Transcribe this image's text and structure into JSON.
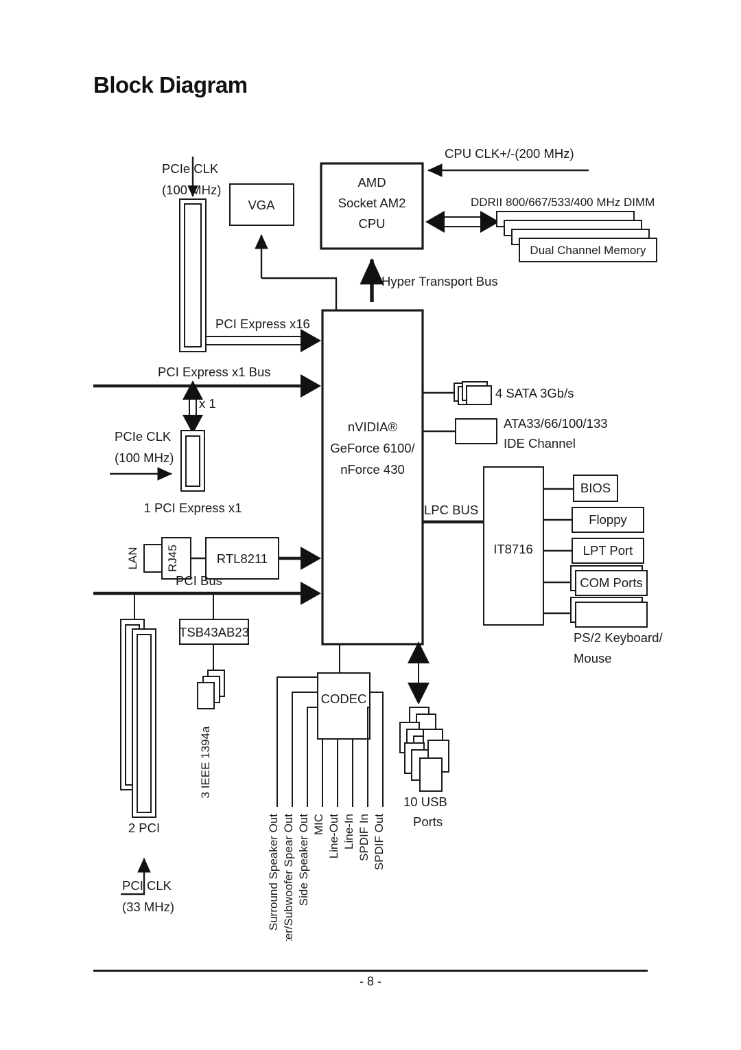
{
  "document": {
    "title": "Block Diagram",
    "footer_page_label": "- 8 -"
  },
  "clocks": {
    "pcie_clk_top_line1": "PCIe CLK",
    "pcie_clk_top_line2": "(100 MHz)",
    "pcie_clk_mid_line1": "PCIe CLK",
    "pcie_clk_mid_line2": "(100 MHz)",
    "pci_clk_line1": "PCI CLK",
    "pci_clk_line2": "(33 MHz)",
    "cpu_clk": "CPU CLK+/-(200 MHz)"
  },
  "blocks": {
    "vga": "VGA",
    "cpu_line1": "AMD",
    "cpu_line2": "Socket AM2",
    "cpu_line3": "CPU",
    "chipset_line1": "nVIDIA®",
    "chipset_line2": "GeForce 6100/",
    "chipset_line3": "nForce 430",
    "memory": "Dual Channel Memory",
    "memory_spec": "DDRII 800/667/533/400 MHz DIMM",
    "lan_phy": "RTL8211",
    "firewire_chip": "TSB43AB23",
    "super_io": "IT8716",
    "codec": "CODEC",
    "bios": "BIOS",
    "floppy": "Floppy",
    "lpt_port": "LPT Port",
    "com_ports": "COM Ports",
    "ps2": "PS/2 Keyboard/\nMouse",
    "ps2_line1": "PS/2 Keyboard/",
    "ps2_line2": "Mouse"
  },
  "buses": {
    "hyper_transport": "Hyper Transport Bus",
    "pci_express_x16": "PCI Express x16",
    "pci_express_x1_bus": "PCI Express x1 Bus",
    "x1_link": "x 1",
    "pci_bus": "PCI Bus",
    "lpc_bus": "LPC BUS"
  },
  "slots": {
    "pcie_x1_label": "1 PCI Express x1",
    "pci_label": "2 PCI"
  },
  "storage": {
    "sata": "4 SATA 3Gb/s",
    "ide_line1": "ATA33/66/100/133",
    "ide_line2": "IDE Channel"
  },
  "io": {
    "lan": "LAN",
    "rj45": "RJ45",
    "ieee1394": "3 IEEE 1394a",
    "usb_line1": "10 USB",
    "usb_line2": "Ports"
  },
  "audio_jacks": [
    "Surround Speaker Out",
    "Center/Subwoofer Spear Out",
    "Side Speaker Out",
    "MIC",
    "Line-Out",
    "Line-In",
    "SPDIF In",
    "SPDIF Out"
  ],
  "colors": {
    "ink": "#1a1a1a",
    "paper": "#ffffff"
  }
}
